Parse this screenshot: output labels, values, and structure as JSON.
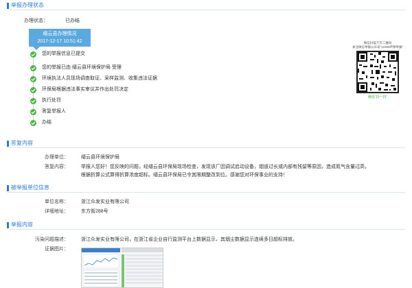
{
  "section_status": {
    "title": "举报办理状态"
  },
  "status": {
    "label": "办理状态：",
    "value": "已办结"
  },
  "timebox": {
    "title": "缙云县办理情况",
    "time": "2017-12-17 10:51:42"
  },
  "progress_steps": [
    "您的举报信息已提交",
    "您的举报已由 缙云县环境保护局 受理",
    "环境执法人员现场调查取证、采样监测、收集违法证据",
    "环保局根据违法事实审议并作出处罚决定",
    "执行处罚",
    "答复举报人",
    "办结"
  ],
  "qr": {
    "caption_line1": "微信扫描下方二维码",
    "caption_line2": "关注微信举报公众号“12369环保举报”",
    "footer": "微信“扫一扫”"
  },
  "section_reply": {
    "title": "答复内容"
  },
  "reply": {
    "unit_label": "办理单位：",
    "unit_value": "缙云县环境保护局",
    "content_label": "答复内容：",
    "content_line1": "举报人您好！您反映的问题，经缙云县环保局现场检查，发现该厂因调试启动设备，烟道过长或内部有残留等原因，造成氮气含量过高，",
    "content_line2": "根据折算公式算得折算浓度超标。缙云县环保局已令其限期整改到位。感谢您对环保事业的支持！"
  },
  "section_reported": {
    "title": "被举报单位信息"
  },
  "reported": {
    "name_label": "单位名称：",
    "name_value": "浙江众发实业有限公司",
    "addr_label": "详细地址：",
    "addr_value": "东方街288号"
  },
  "section_report": {
    "title": "举报内容"
  },
  "report": {
    "desc_label": "污染问题描述：",
    "desc_value": "浙江众发实业有限公司，在浙江省企业自行监测平台上数据显示，其烟尘数据显示连续多日超标排放。",
    "image_label": "证据图片："
  },
  "colors": {
    "accent": "#2b7cd3",
    "timebox": "#5aa9df",
    "step_green": "#4fb448"
  }
}
